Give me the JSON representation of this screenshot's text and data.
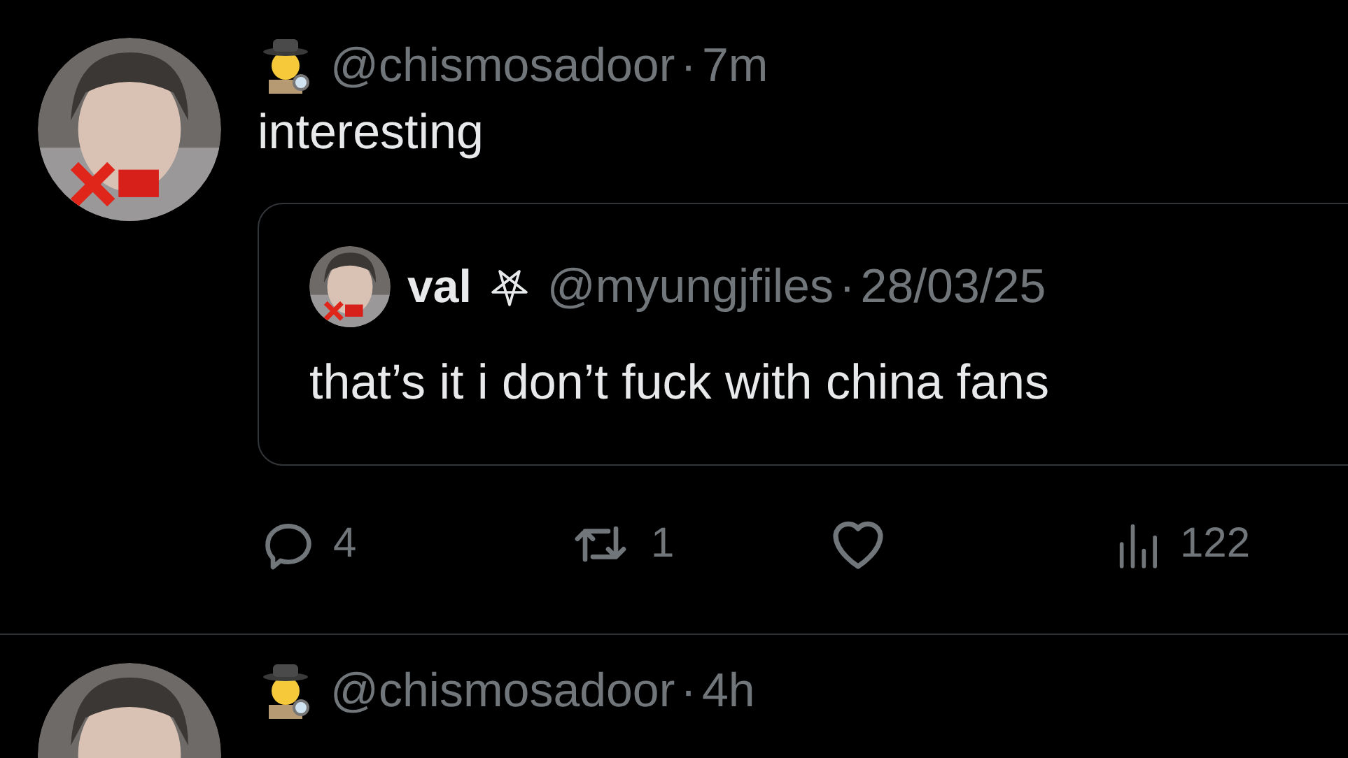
{
  "tweets": [
    {
      "handle": "@chismosadoor",
      "separator": "·",
      "time": "7m",
      "text": "interesting",
      "quote": {
        "name": "val",
        "handle": "@myungjfiles",
        "separator": "·",
        "date": "28/03/25",
        "text": "that’s it i don’t fuck with china fans"
      },
      "actions": {
        "replies": "4",
        "reposts": "1",
        "views": "122",
        "liked": false
      }
    },
    {
      "handle": "@chismosadoor",
      "separator": "·",
      "time": "4h"
    }
  ]
}
